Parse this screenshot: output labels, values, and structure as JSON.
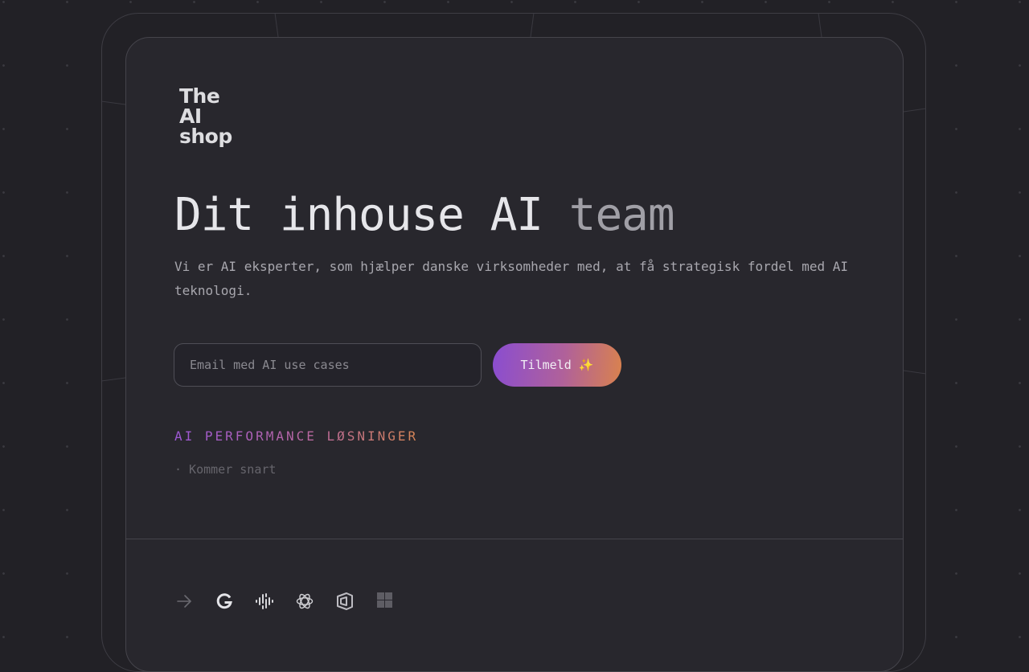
{
  "brand": {
    "logo_lines": [
      "The",
      "AI",
      "shop"
    ]
  },
  "hero": {
    "headline_main": "Dit inhouse AI ",
    "headline_faded": "team",
    "subtitle": "Vi er AI eksperter, som hjælper danske virksomheder med, at få strategisk fordel med AI teknologi."
  },
  "signup": {
    "email_placeholder": "Email med AI use cases",
    "email_value": "",
    "button_label": "Tilmeld ✨"
  },
  "solutions": {
    "section_label": "AI PERFORMANCE LØSNINGER",
    "coming_soon": "· Kommer snart"
  },
  "partner_icons": [
    "arrow-right-icon",
    "google-icon",
    "podcast-waveform-icon",
    "openai-icon",
    "azure-cube-icon",
    "microsoft-windows-icon"
  ],
  "colors": {
    "background": "#222126",
    "card": "#28272d",
    "gradient_start": "#8a4dd0",
    "gradient_end": "#d9824e",
    "text_primary": "#e6e6ea",
    "text_muted": "#a8a7ae"
  }
}
